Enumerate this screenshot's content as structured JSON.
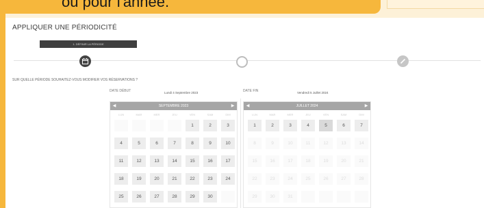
{
  "callout": {
    "text": "ou pour l'année."
  },
  "section_title": "APPLIQUER UNE PÉRIODICITÉ",
  "step_tag": "1. DÉFINIR LA PÉRIODE",
  "question": "SUR QUELLE PÉRIODE SOUHAITEZ-VOUS MODIFIER VOS RÉSERVATIONS ?",
  "start": {
    "label": "DATE DÉBUT",
    "value": "Lundi 4 Septembre 2023",
    "calendar": {
      "month_title": "SEPTEMBRE 2023",
      "prev": "◀",
      "next": "▶",
      "weekdays": [
        "LUN",
        "MAR",
        "MER",
        "JEU",
        "VEN",
        "SAM",
        "DIM"
      ],
      "weeks": [
        [
          "",
          "",
          "",
          "",
          "1",
          "2",
          "3"
        ],
        [
          "4",
          "5",
          "6",
          "7",
          "8",
          "9",
          "10"
        ],
        [
          "11",
          "12",
          "13",
          "14",
          "15",
          "16",
          "17"
        ],
        [
          "18",
          "19",
          "20",
          "21",
          "22",
          "23",
          "24"
        ],
        [
          "25",
          "26",
          "27",
          "28",
          "29",
          "30",
          ""
        ]
      ]
    }
  },
  "end": {
    "label": "DATE FIN",
    "value": "Vendredi 5 Juillet 2024",
    "calendar": {
      "month_title": "JUILLET 2024",
      "prev": "◀",
      "next": "▶",
      "weekdays": [
        "LUN",
        "MAR",
        "MER",
        "JEU",
        "VEN",
        "SAM",
        "DIM"
      ],
      "weeks": [
        [
          "1",
          "2",
          "3",
          "4",
          "5",
          "6",
          "7"
        ],
        [
          "8",
          "9",
          "10",
          "11",
          "12",
          "13",
          "14"
        ],
        [
          "15",
          "16",
          "17",
          "18",
          "19",
          "20",
          "21"
        ],
        [
          "22",
          "23",
          "24",
          "25",
          "26",
          "27",
          "28"
        ],
        [
          "29",
          "30",
          "31",
          "",
          "",
          "",
          ""
        ]
      ]
    }
  },
  "colors": {
    "accent": "#f6b73c",
    "step_active": "#444444",
    "calendar_header": "#a6a6a6"
  },
  "icons": {
    "step1": "calendar-icon",
    "step3": "edit-icon"
  }
}
